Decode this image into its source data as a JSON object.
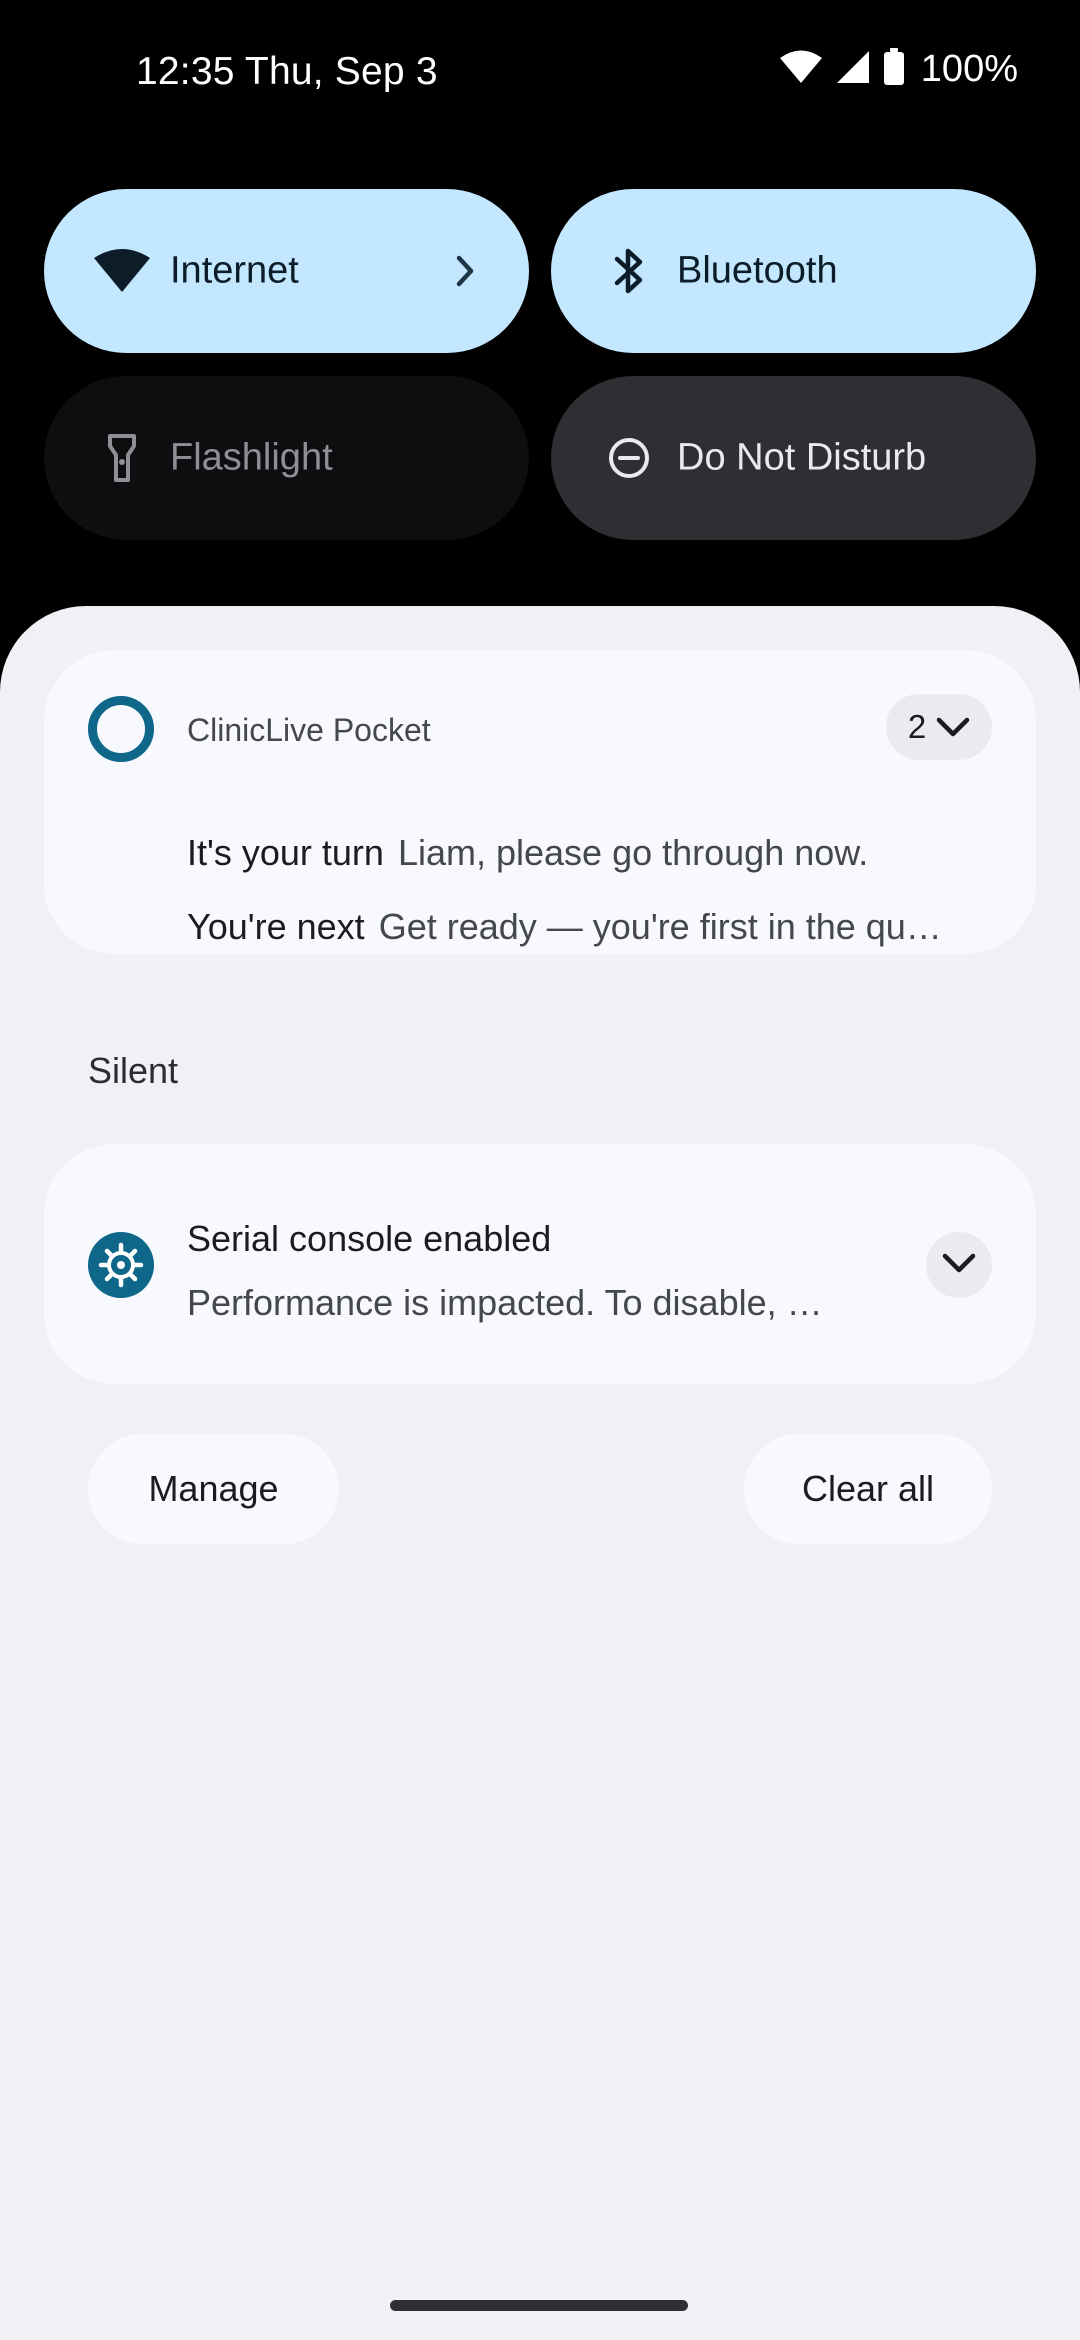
{
  "status_bar": {
    "time_date": "12:35 Thu, Sep 3",
    "battery": "100%",
    "icons": [
      "wifi-icon",
      "signal-icon",
      "battery-icon"
    ]
  },
  "quick_settings": [
    {
      "label": "Internet",
      "icon": "wifi-icon",
      "state": "on",
      "has_chevron": true
    },
    {
      "label": "Bluetooth",
      "icon": "bluetooth-icon",
      "state": "on"
    },
    {
      "label": "Flashlight",
      "icon": "flashlight-icon",
      "state": "off"
    },
    {
      "label": "Do Not Disturb",
      "icon": "do-not-disturb-icon",
      "state": "off"
    }
  ],
  "notifications": {
    "clinic": {
      "app_name": "ClinicLive Pocket",
      "count": "2",
      "messages": [
        {
          "title": "It's your turn",
          "body": "Liam, please go through now."
        },
        {
          "title": "You're next",
          "body": "Get ready — you're first in the qu…"
        }
      ]
    },
    "silent_header": "Silent",
    "serial": {
      "title": "Serial console enabled",
      "body": "Performance is impacted. To disable, …"
    }
  },
  "actions": {
    "manage": "Manage",
    "clear_all": "Clear all"
  },
  "colors": {
    "tile_on": "#c3e7fe",
    "tile_off": "#0e0e10",
    "accent": "#0e6788",
    "shade_bg": "#f0f1f4",
    "card_bg": "#f8f9fe"
  }
}
